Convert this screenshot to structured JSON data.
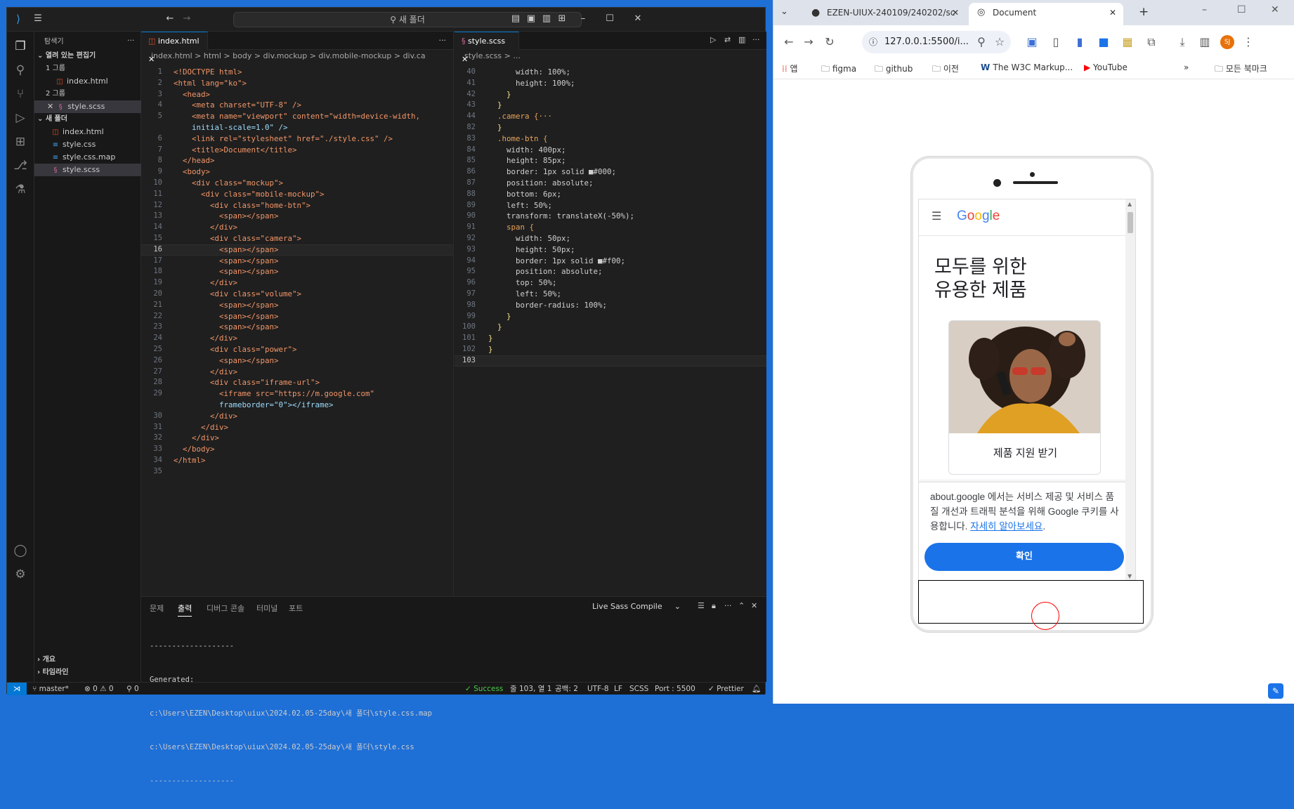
{
  "vscode": {
    "search": "새 폴더",
    "explorer_title": "탐색기",
    "open_editors": "열려 있는 편집기",
    "group1": "1 그룹",
    "group1_file": "index.html",
    "group2": "2 그룹",
    "group2_file": "style.scss",
    "folder": "새 폴더",
    "files": [
      "index.html",
      "style.css",
      "style.css.map",
      "style.scss"
    ],
    "outline": "개요",
    "timeline": "타임라인",
    "left_tab": "index.html",
    "left_crumb": "index.html > html > body > div.mockup > div.mobile-mockup > div.ca",
    "right_tab": "style.scss",
    "right_crumb": "style.scss > ...",
    "html_lines": [
      {
        "n": "1",
        "t": "<!DOCTYPE html>"
      },
      {
        "n": "2",
        "t": "<html lang=\"ko\">"
      },
      {
        "n": "3",
        "t": "  <head>"
      },
      {
        "n": "4",
        "t": "    <meta charset=\"UTF-8\" />"
      },
      {
        "n": "5",
        "t": "    <meta name=\"viewport\" content=\"width=device-width,"
      },
      {
        "n": "",
        "t": "    initial-scale=1.0\" />"
      },
      {
        "n": "6",
        "t": "    <link rel=\"stylesheet\" href=\"./style.css\" />"
      },
      {
        "n": "7",
        "t": "    <title>Document</title>"
      },
      {
        "n": "8",
        "t": "  </head>"
      },
      {
        "n": "9",
        "t": "  <body>"
      },
      {
        "n": "10",
        "t": "    <div class=\"mockup\">"
      },
      {
        "n": "11",
        "t": "      <div class=\"mobile-mockup\">"
      },
      {
        "n": "12",
        "t": "        <div class=\"home-btn\">"
      },
      {
        "n": "13",
        "t": "          <span></span>"
      },
      {
        "n": "14",
        "t": "        </div>"
      },
      {
        "n": "15",
        "t": "        <div class=\"camera\">"
      },
      {
        "n": "16",
        "t": "          <span></span>"
      },
      {
        "n": "17",
        "t": "          <span></span>"
      },
      {
        "n": "18",
        "t": "          <span></span>"
      },
      {
        "n": "19",
        "t": "        </div>"
      },
      {
        "n": "20",
        "t": "        <div class=\"volume\">"
      },
      {
        "n": "21",
        "t": "          <span></span>"
      },
      {
        "n": "22",
        "t": "          <span></span>"
      },
      {
        "n": "23",
        "t": "          <span></span>"
      },
      {
        "n": "24",
        "t": "        </div>"
      },
      {
        "n": "25",
        "t": "        <div class=\"power\">"
      },
      {
        "n": "26",
        "t": "          <span></span>"
      },
      {
        "n": "27",
        "t": "        </div>"
      },
      {
        "n": "28",
        "t": "        <div class=\"iframe-url\">"
      },
      {
        "n": "29",
        "t": "          <iframe src=\"https://m.google.com\""
      },
      {
        "n": "",
        "t": "          frameborder=\"0\"></iframe>"
      },
      {
        "n": "30",
        "t": "        </div>"
      },
      {
        "n": "31",
        "t": "      </div>"
      },
      {
        "n": "32",
        "t": "    </div>"
      },
      {
        "n": "33",
        "t": "  </body>"
      },
      {
        "n": "34",
        "t": "</html>"
      },
      {
        "n": "35",
        "t": ""
      }
    ],
    "scss_lines": [
      {
        "n": "40",
        "t": "      width: 100%;"
      },
      {
        "n": "41",
        "t": "      height: 100%;"
      },
      {
        "n": "42",
        "t": "    }"
      },
      {
        "n": "43",
        "t": "  }"
      },
      {
        "n": "44",
        "t": "  .camera {···"
      },
      {
        "n": "82",
        "t": "  }"
      },
      {
        "n": "83",
        "t": "  .home-btn {"
      },
      {
        "n": "84",
        "t": "    width: 400px;"
      },
      {
        "n": "85",
        "t": "    height: 85px;"
      },
      {
        "n": "86",
        "t": "    border: 1px solid ■#000;"
      },
      {
        "n": "87",
        "t": "    position: absolute;"
      },
      {
        "n": "88",
        "t": "    bottom: 6px;"
      },
      {
        "n": "89",
        "t": "    left: 50%;"
      },
      {
        "n": "90",
        "t": "    transform: translateX(-50%);"
      },
      {
        "n": "91",
        "t": "    span {"
      },
      {
        "n": "92",
        "t": "      width: 50px;"
      },
      {
        "n": "93",
        "t": "      height: 50px;"
      },
      {
        "n": "94",
        "t": "      border: 1px solid ■#f00;"
      },
      {
        "n": "95",
        "t": "      position: absolute;"
      },
      {
        "n": "96",
        "t": "      top: 50%;"
      },
      {
        "n": "97",
        "t": "      left: 50%;"
      },
      {
        "n": "98",
        "t": "      border-radius: 100%;"
      },
      {
        "n": "99",
        "t": "    }"
      },
      {
        "n": "100",
        "t": "  }"
      },
      {
        "n": "101",
        "t": "}"
      },
      {
        "n": "102",
        "t": "}"
      },
      {
        "n": "103",
        "t": ""
      }
    ],
    "panel_tabs": [
      "문제",
      "출력",
      "디버그 콘솔",
      "터미널",
      "포트"
    ],
    "panel_select": "Live Sass Compile",
    "output": [
      "-------------------",
      "Generated:",
      "c:\\Users\\EZEN\\Desktop\\uiux\\2024.02.05-25day\\새 폴더\\style.css.map",
      "c:\\Users\\EZEN\\Desktop\\uiux\\2024.02.05-25day\\새 폴더\\style.css",
      "-------------------"
    ],
    "status": {
      "branch": "master*",
      "problems": "⊗ 0 ⚠ 0",
      "ports": "⚲ 0",
      "success": "✓ Success",
      "position": "줄 103, 열 1",
      "spaces": "공백: 2",
      "encoding": "UTF-8",
      "eol": "LF",
      "lang": "SCSS",
      "port": "Port : 5500",
      "prettier": "✓ Prettier"
    }
  },
  "chrome": {
    "tab1": "EZEN-UIUX-240109/240202/sc",
    "tab2": "Document",
    "url": "127.0.0.1:5500/i...",
    "bookmarks": [
      "앱",
      "figma",
      "github",
      "이전",
      "The W3C Markup...",
      "YouTube"
    ],
    "all_bookmarks": "모든 북마크",
    "profile": "SJ"
  },
  "google_page": {
    "logo": "Google",
    "headline1": "모두를 위한",
    "headline2": "유용한 제품",
    "support": "제품 지원 받기",
    "cookie_text": "about.google 에서는 서비스 제공 및 서비스 품질 개선과 트래픽 분석을 위해 Google 쿠키를 사용합니다.",
    "learn_more": "자세히 알아보세요",
    "confirm": "확인"
  }
}
